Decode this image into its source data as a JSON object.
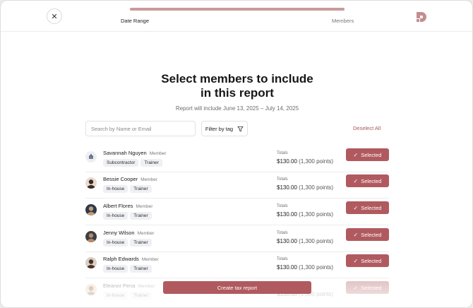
{
  "header": {
    "close_label": "✕",
    "progress": 1.0,
    "steps": [
      "Date Range",
      "Members"
    ],
    "logo": "brand-logo-icon"
  },
  "main": {
    "title_line1": "Select members to include",
    "title_line2": "in this report",
    "subtitle": "Report will include June 13, 2025 – July 14, 2025"
  },
  "toolbar": {
    "search_placeholder": "Search by Name or Email",
    "filter_label": "Filter by tag",
    "filter_icon": "funnel-icon",
    "deselect_label": "Deselect All"
  },
  "members": [
    {
      "name": "Savannah Nguyen",
      "role": "Member",
      "tags": [
        "Subcontractor",
        "Trainer"
      ],
      "totals_label": "Totals",
      "amount": "$130.00",
      "points": "(1,300 points)",
      "button": "Selected",
      "avatar": "company-logo-avatar"
    },
    {
      "name": "Bessie Cooper",
      "role": "Member",
      "tags": [
        "In-house",
        "Trainer"
      ],
      "totals_label": "Totals",
      "amount": "$130.00",
      "points": "(1,300 points)",
      "button": "Selected",
      "avatar": "person-avatar"
    },
    {
      "name": "Albert Flores",
      "role": "Member",
      "tags": [
        "In-house",
        "Trainer"
      ],
      "totals_label": "Totals",
      "amount": "$130.00",
      "points": "(1,300 points)",
      "button": "Selected",
      "avatar": "person-avatar"
    },
    {
      "name": "Jenny Wilson",
      "role": "Member",
      "tags": [
        "In-house",
        "Trainer"
      ],
      "totals_label": "Totals",
      "amount": "$130.00",
      "points": "(1,300 points)",
      "button": "Selected",
      "avatar": "person-avatar"
    },
    {
      "name": "Ralph Edwards",
      "role": "Member",
      "tags": [
        "In-house",
        "Trainer"
      ],
      "totals_label": "Totals",
      "amount": "$130.00",
      "points": "(1,300 points)",
      "button": "Selected",
      "avatar": "person-avatar"
    },
    {
      "name": "Eleanor Pena",
      "role": "Member",
      "tags": [
        "In-house",
        "Trainer"
      ],
      "totals_label": "Totals",
      "amount": "$130.00",
      "points": "(1,300 points)",
      "button": "Selected",
      "avatar": "person-avatar"
    }
  ],
  "footer": {
    "cta_label": "Create tax report"
  },
  "colors": {
    "accent": "#b05a5f",
    "progress_fill": "#c89a9c",
    "tag_bg": "#eff0f3"
  }
}
